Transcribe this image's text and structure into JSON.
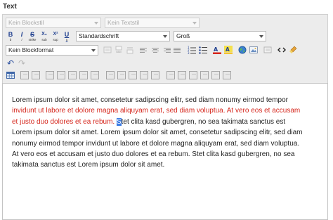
{
  "field_label": "Text",
  "toolbar": {
    "block_style": "Kein Blockstil",
    "text_style": "Kein Textstil",
    "font_family": "Standardschrift",
    "font_size": "Groß",
    "block_format": "Kein Blockformat",
    "bold_glyph": "B",
    "bold_sub": "b",
    "italic_glyph": "I",
    "italic_sub": "i",
    "strike_glyph": "S",
    "strike_sub": "strike",
    "subscript_glyph": "X₂",
    "subscript_sub": "sub",
    "superscript_glyph": "X²",
    "superscript_sub": "sup",
    "underline_glyph": "U",
    "underline_sub": "u",
    "undo_glyph": "↶",
    "redo_glyph": "↷"
  },
  "content": {
    "p1": "Lorem ipsum dolor sit amet, consetetur sadipscing elitr, sed diam nonumy eirmod tempor",
    "p2_red": "invidunt ut labore et dolore magna aliquyam erat, sed diam voluptua. At vero eos et accusam et justo duo dolores et ea rebum.",
    "p3_space": " ",
    "p3_selected": "S",
    "p3_rest": "tet clita kasd gubergren, no sea takimata sanctus est Lorem ipsum dolor sit amet. Lorem ipsum dolor sit amet, consetetur sadipscing elitr, sed diam nonumy eirmod tempor invidunt ut labore et dolore magna aliquyam erat, sed diam voluptua. At vero eos et accusam et justo duo dolores et ea rebum. Stet clita kasd gubergren, no sea takimata sanctus est Lorem ipsum dolor sit amet."
  },
  "colors": {
    "red_text": "#d5261c",
    "selection": "#3c7be3",
    "toolbar_bg": "#ececec",
    "active_button": "#fbe7a8"
  },
  "icons": {
    "link": "link-icon",
    "image": "image-icon",
    "globe": "globe-icon",
    "source": "source-code-icon",
    "clean": "clean-format-icon"
  }
}
